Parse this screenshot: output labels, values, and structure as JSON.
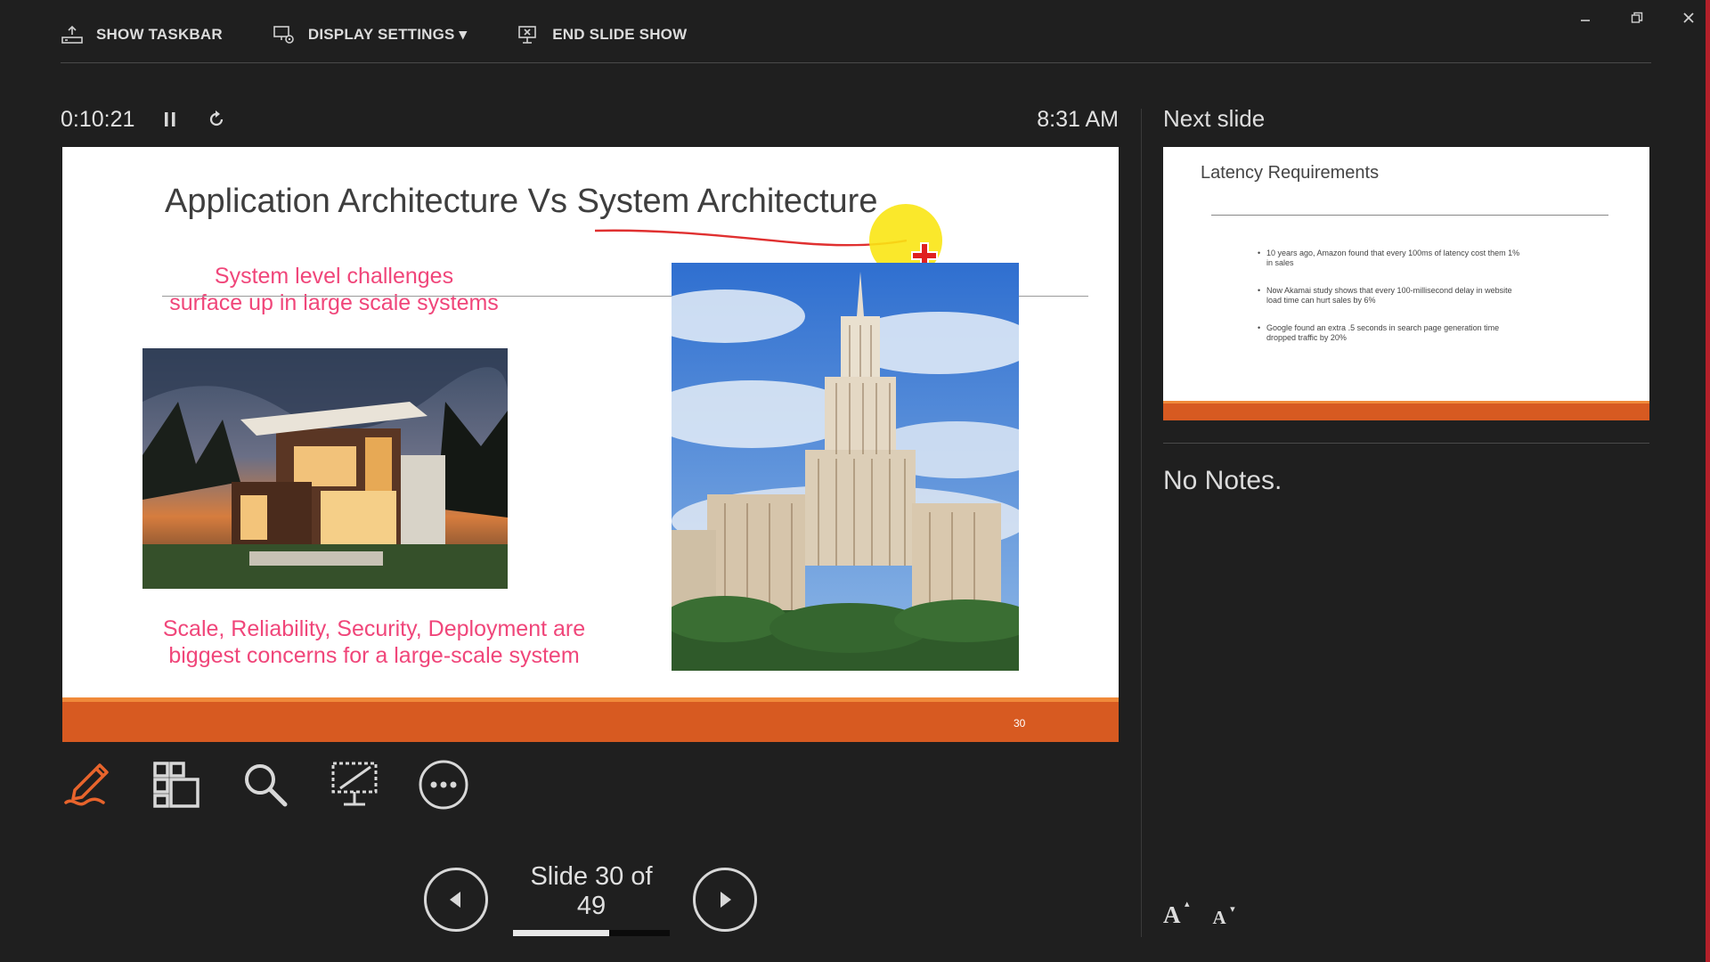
{
  "toolbar": {
    "show_taskbar": "SHOW TASKBAR",
    "display_settings": "DISPLAY SETTINGS ▾",
    "end_slide_show": "END SLIDE SHOW"
  },
  "timer": {
    "elapsed": "0:10:21",
    "clock": "8:31 AM"
  },
  "current_slide": {
    "title": "Application Architecture Vs System Architecture",
    "subheading_line1": "System level challenges",
    "subheading_line2": "surface up in large scale systems",
    "bottom_line1": "Scale, Reliability, Security, Deployment are",
    "bottom_line2": "biggest concerns for a large-scale system",
    "slide_number": "30"
  },
  "navigation": {
    "label": "Slide 30 of 49",
    "current": 30,
    "total": 49
  },
  "next_slide": {
    "header": "Next slide",
    "title": "Latency Requirements",
    "bullets": [
      "10 years ago, Amazon found that every 100ms of latency cost them 1% in sales",
      "Now Akamai study shows that every 100-millisecond delay in website load time can hurt sales by 6%",
      "Google found an extra .5 seconds in search page generation time dropped traffic by 20%"
    ]
  },
  "notes": {
    "text": "No Notes."
  },
  "font_buttons": {
    "increase": "A",
    "decrease": "A"
  },
  "colors": {
    "accent_orange": "#d75a21",
    "pen_orange": "#e8642c",
    "slide_pink": "#f0467a",
    "window_edge": "#b3202a"
  },
  "icons": {
    "pen_tool": "pen-icon",
    "see_all_slides": "grid-icon",
    "zoom": "magnifier-icon",
    "black_screen": "black-screen-icon",
    "more_options": "more-icon"
  }
}
